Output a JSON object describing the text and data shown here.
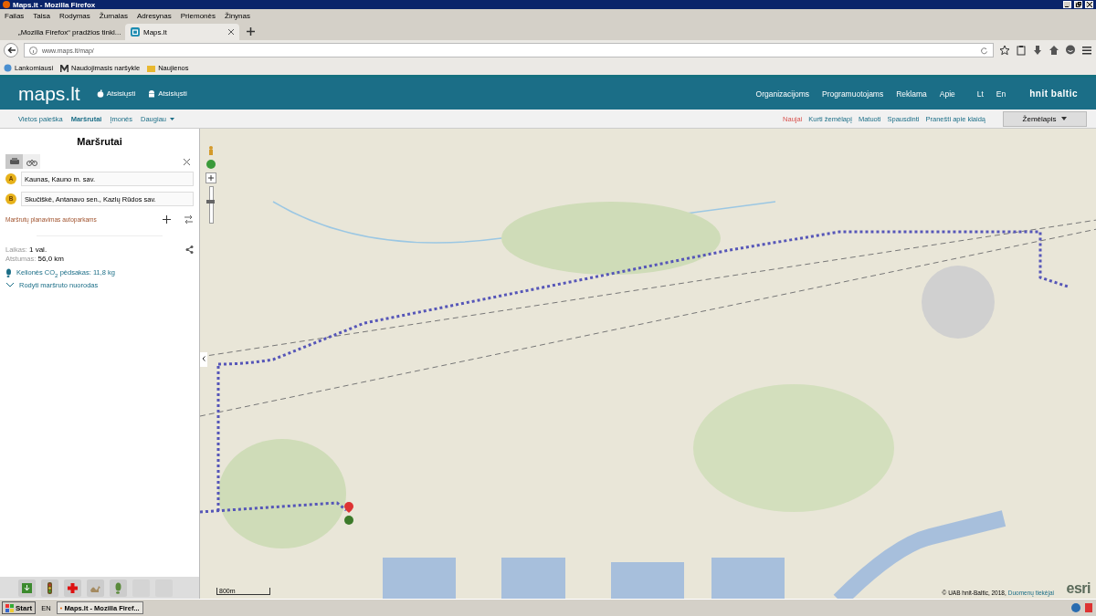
{
  "window": {
    "title": "Maps.lt - Mozilla Firefox"
  },
  "menu": [
    "Failas",
    "Taisa",
    "Rodymas",
    "Žurnalas",
    "Adresynas",
    "Priemonės",
    "Žinynas"
  ],
  "tabs": [
    {
      "label": "„Mozilla Firefox“ pradžios tinkl...",
      "selected": false
    },
    {
      "label": "Maps.lt",
      "selected": true
    }
  ],
  "address": {
    "value": "www.maps.lt/map/"
  },
  "bookmarks": [
    "Lankomiausi",
    "Naudojimasis naršykle",
    "Naujienos"
  ],
  "site": {
    "logo": "maps.lt",
    "downloads": [
      "Atsisiųsti",
      "Atsisiųsti"
    ],
    "nav": [
      "Organizacijoms",
      "Programuotojams",
      "Reklama",
      "Apie"
    ],
    "langs": [
      "Lt",
      "En"
    ],
    "brand": "hnit baltic"
  },
  "subnav": [
    {
      "label": "Vietos paieška",
      "selected": false
    },
    {
      "label": "Maršrutai",
      "selected": true
    },
    {
      "label": "Įmonės",
      "selected": false
    },
    {
      "label": "Daugiau",
      "selected": false
    }
  ],
  "map_links": [
    {
      "label": "Naujai",
      "kind": "new"
    },
    {
      "label": "Kurti žemėlapį",
      "kind": "link"
    },
    {
      "label": "Matuoti",
      "kind": "link"
    },
    {
      "label": "Spausdinti",
      "kind": "link"
    },
    {
      "label": "Pranešti apie klaidą",
      "kind": "link"
    }
  ],
  "layer_select": "Žemėlapis",
  "panel": {
    "title": "Maršrutai",
    "modes": [
      {
        "kind": "car",
        "selected": true
      },
      {
        "kind": "bike",
        "selected": false
      }
    ],
    "stops": [
      {
        "letter": "A",
        "value": "Kaunas, Kauno m. sav."
      },
      {
        "letter": "B",
        "value": "Skučiškė, Antanavo sen., Kazlų Rūdos sav."
      }
    ],
    "fleet_link": "Maršrutų planavimas autoparkams",
    "time_label": "Laikas:",
    "time": "1 val.",
    "dist_label": "Atstumas:",
    "dist": "56,0 km",
    "co2": "Kelionės CO$_{2}$ pėdsakas: 11,8 kg",
    "show_steps": "Rodyti maršruto nuorodas"
  },
  "zoom": {
    "level": 0.6
  },
  "scale": "800m",
  "copyright": "© UAB hnit-Baltic, 2018,",
  "data_link": "Duomenų tiekėjai",
  "esri": "esri",
  "taskbar": {
    "start": "Start",
    "lang": "EN",
    "task": "Maps.lt - Mozilla Firef..."
  }
}
